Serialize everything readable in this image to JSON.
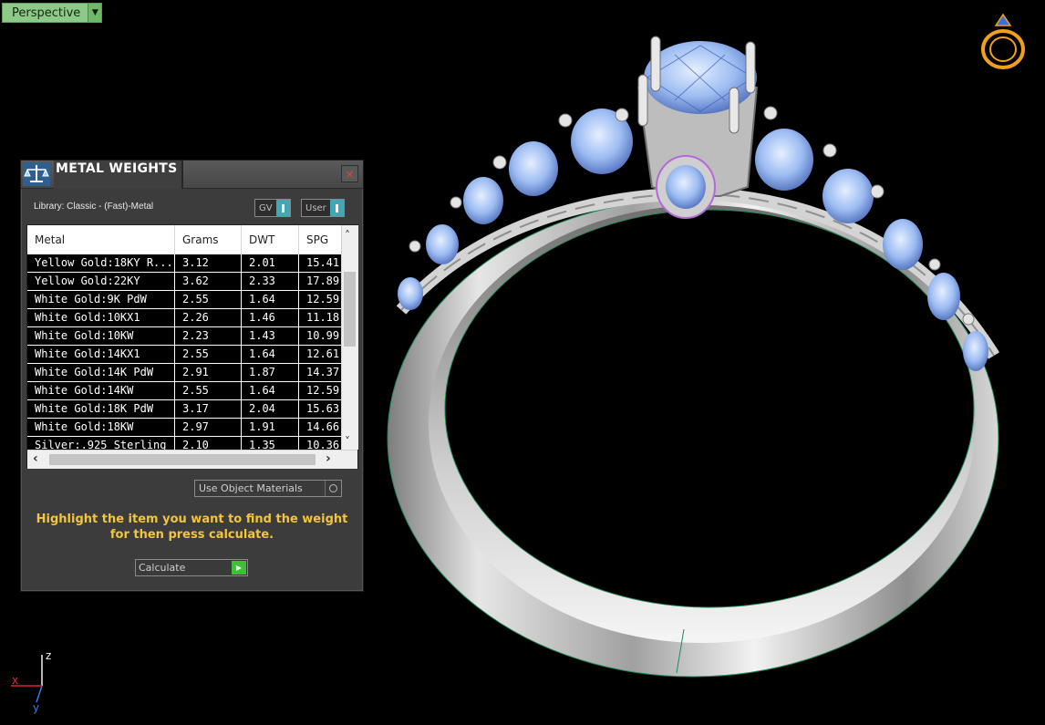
{
  "viewport": {
    "view_label": "Perspective",
    "axis_labels": {
      "x": "x",
      "y": "y",
      "z": "z"
    }
  },
  "panel": {
    "title": "METAL WEIGHTS",
    "close_glyph": "×",
    "library_label": "Library: Classic - (Fast)-Metal",
    "toggle_gv": "GV",
    "toggle_user": "User",
    "table": {
      "columns": [
        "Metal",
        "Grams",
        "DWT",
        "SPG"
      ],
      "rows": [
        [
          "Yellow Gold:18KY R...",
          "3.12",
          "2.01",
          "15.41"
        ],
        [
          "Yellow Gold:22KY",
          "3.62",
          "2.33",
          "17.89"
        ],
        [
          "White Gold:9K PdW",
          "2.55",
          "1.64",
          "12.59"
        ],
        [
          "White Gold:10KX1",
          "2.26",
          "1.46",
          "11.18"
        ],
        [
          "White Gold:10KW",
          "2.23",
          "1.43",
          "10.99"
        ],
        [
          "White Gold:14KX1",
          "2.55",
          "1.64",
          "12.61"
        ],
        [
          "White Gold:14K PdW",
          "2.91",
          "1.87",
          "14.37"
        ],
        [
          "White Gold:14KW",
          "2.55",
          "1.64",
          "12.59"
        ],
        [
          "White Gold:18K PdW",
          "3.17",
          "2.04",
          "15.63"
        ],
        [
          "White Gold:18KW",
          "2.97",
          "1.91",
          "14.66"
        ],
        [
          "Silver:.925 Sterling",
          "2.10",
          "1.35",
          "10.36"
        ]
      ]
    },
    "use_object_materials": "Use Object Materials",
    "hint_line1": "Highlight the item you want to find the weight",
    "hint_line2": "for then press calculate.",
    "calculate_label": "Calculate"
  },
  "colors": {
    "view_tab": "#8fc98a",
    "hint_text": "#f4c43c",
    "toggle_accent": "#3fa7b5",
    "calculate_go": "#3fbf35",
    "gem": "#8fb3ee",
    "metal": "#c9c9c9"
  },
  "icons": {
    "view_dropdown": "chevron-down-icon",
    "panel_logo": "scale-icon",
    "close": "close-icon",
    "calculate": "play-icon",
    "gizmo": "ring-gizmo-icon"
  }
}
